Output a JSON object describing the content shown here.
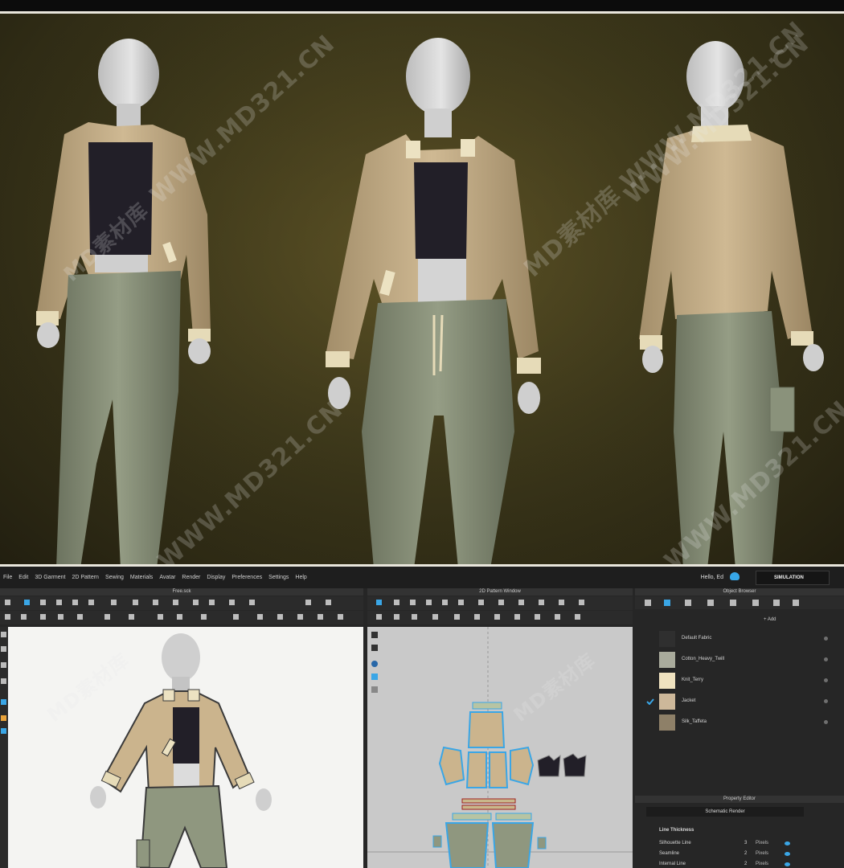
{
  "watermarks": {
    "domain": "WWW.MD321.CN",
    "domain_alt": "WWW.MD321.CN",
    "cn": "MD素材库",
    "combo": "MD素材库 WWW.MD321.CN"
  },
  "menu": {
    "items": [
      "File",
      "Edit",
      "3D Garment",
      "2D Pattern",
      "Sewing",
      "Materials",
      "Avatar",
      "Render",
      "Display",
      "Preferences",
      "Settings",
      "Help"
    ],
    "user": "Hello, Ed",
    "mode_button": "SIMULATION"
  },
  "panels": {
    "free_window": "Free.sck",
    "pattern_window": "2D Pattern Window",
    "object_browser": "Object Browser",
    "property_editor": "Property Editor"
  },
  "browser": {
    "add_label": "+ Add",
    "fabrics": [
      {
        "name": "Default Fabric",
        "color": "#2f2f2f",
        "checked": false
      },
      {
        "name": "Cotton_Heavy_Twill",
        "color": "#a9ab9c",
        "checked": false
      },
      {
        "name": "Knit_Terry",
        "color": "#efe2bf",
        "checked": false
      },
      {
        "name": "Jacket",
        "color": "#cdb89a",
        "checked": true
      },
      {
        "name": "Silk_Taffeta",
        "color": "#8e8068",
        "checked": false
      }
    ]
  },
  "property": {
    "tab": "Schematic Render",
    "section": "Line Thickness",
    "rows": [
      {
        "label": "Silhouette Line",
        "value": "3",
        "unit": "Pixels"
      },
      {
        "label": "Seamline",
        "value": "2",
        "unit": "Pixels"
      },
      {
        "label": "Internal Line",
        "value": "2",
        "unit": "Pixels"
      }
    ]
  },
  "colors": {
    "jacket": "#cbb48d",
    "jacket_shadow": "#a8926c",
    "cuff": "#e6dbb8",
    "top": "#221f28",
    "pants": "#8f977f",
    "pants_shadow": "#6f7662",
    "skin": "#dadada",
    "accent": "#3aa6e6"
  }
}
